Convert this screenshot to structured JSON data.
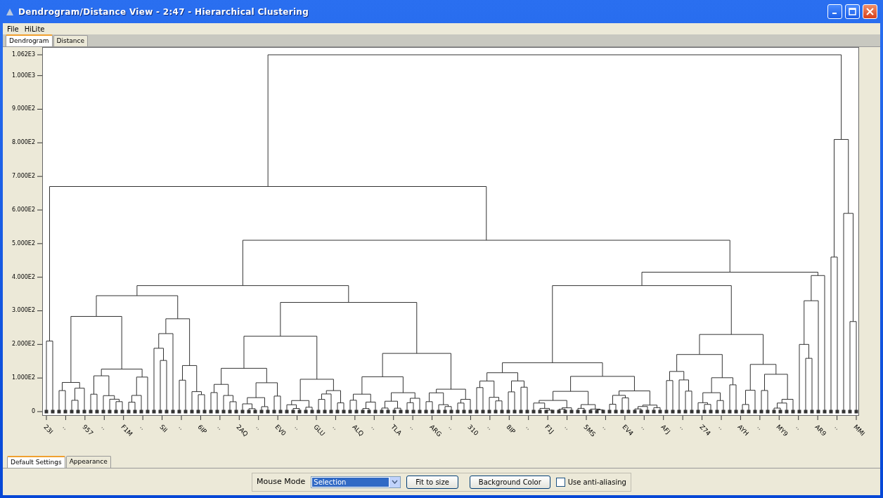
{
  "window": {
    "title": "Dendrogram/Distance View - 2:47 - Hierarchical Clustering"
  },
  "menu": [
    "File",
    "HiLite"
  ],
  "tabs": [
    {
      "label": "Dendrogram",
      "selected": true
    },
    {
      "label": "Distance",
      "selected": false
    }
  ],
  "y_axis": {
    "ticks": [
      "1.062E3",
      "1.000E3",
      "9.000E2",
      "8.000E2",
      "7.000E2",
      "6.000E2",
      "5.000E2",
      "4.000E2",
      "3.000E2",
      "2.000E2",
      "1.000E2",
      "0"
    ]
  },
  "x_axis": {
    "labels": [
      "23I",
      "..",
      "957",
      "..",
      "F1M",
      "..",
      "SII",
      "..",
      "6IP",
      "..",
      "2AQ",
      "..",
      "EV0",
      "..",
      "GLU",
      "..",
      "ALQ",
      "..",
      "TLA",
      "..",
      "ARG",
      "..",
      "310",
      "..",
      "8IP",
      "..",
      "F1J",
      "..",
      "5MS",
      "..",
      "EV4",
      "..",
      "AFJ",
      "..",
      "Z74",
      "..",
      "AYH",
      "..",
      "MY9",
      "..",
      "AR9",
      "..",
      "MMI"
    ]
  },
  "settings_tabs": [
    {
      "label": "Default Settings",
      "selected": true
    },
    {
      "label": "Appearance",
      "selected": false
    }
  ],
  "controls": {
    "mouse_mode_label": "Mouse Mode",
    "mouse_mode": "Selection",
    "buttons": [
      "Fit to size",
      "Background Color"
    ],
    "anti_aliasing": {
      "label": "Use anti-aliasing",
      "checked": false
    }
  }
}
